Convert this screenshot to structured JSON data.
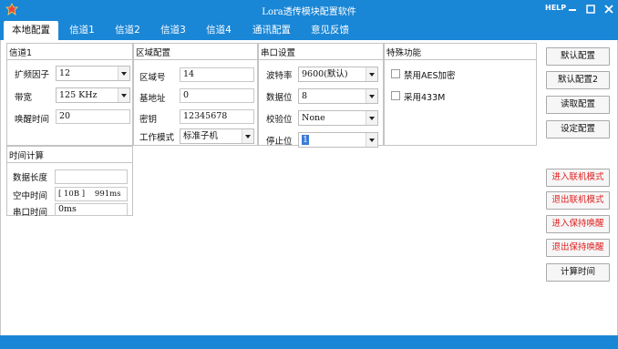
{
  "window": {
    "title": "Lora透传模块配置软件",
    "help_label": "HELP",
    "min_icon": "minimize-icon",
    "max_icon": "maximize-icon",
    "close_icon": "close-icon",
    "colors": {
      "titlebar": "#1a86d6",
      "red_button_text": "#e02020"
    }
  },
  "tabs": [
    {
      "label": "本地配置",
      "active": true
    },
    {
      "label": "信道1"
    },
    {
      "label": "信道2"
    },
    {
      "label": "信道3"
    },
    {
      "label": "信道4"
    },
    {
      "label": "通讯配置"
    },
    {
      "label": "意见反馈"
    }
  ],
  "channel": {
    "title": "信道1",
    "spread_factor": {
      "label": "扩频因子",
      "value": "12"
    },
    "bandwidth": {
      "label": "带宽",
      "value": "125 KHz"
    },
    "wake_time": {
      "label": "唤醒时间",
      "value": "20"
    }
  },
  "region": {
    "title": "区域配置",
    "area_id": {
      "label": "区域号",
      "value": "14"
    },
    "base_addr": {
      "label": "基地址",
      "value": "0"
    },
    "key": {
      "label": "密钥",
      "value": "12345678"
    },
    "work_mode": {
      "label": "工作模式",
      "value": "标准子机"
    }
  },
  "serial": {
    "title": "串口设置",
    "baud": {
      "label": "波特率",
      "value": "9600(默认)"
    },
    "data_bits": {
      "label": "数据位",
      "value": "8"
    },
    "parity": {
      "label": "校验位",
      "value": "None"
    },
    "stop_bits": {
      "label": "停止位",
      "value": "1"
    }
  },
  "special": {
    "title": "特殊功能",
    "disable_aes": {
      "label": "禁用AES加密",
      "checked": false
    },
    "use_433m": {
      "label": "采用433M",
      "checked": false
    }
  },
  "timing": {
    "title": "时间计算",
    "data_length": {
      "label": "数据长度",
      "value": ""
    },
    "air_time": {
      "label": "空中时间",
      "value": "[ 10B ]    991ms"
    },
    "serial_time": {
      "label": "串口时间",
      "value": "0ms"
    }
  },
  "buttons": {
    "default_config": "默认配置",
    "default_config2": "默认配置2",
    "read_config": "读取配置",
    "set_config": "设定配置",
    "enter_online": "进入联机模式",
    "exit_online": "退出联机模式",
    "enter_keepwake": "进入保持唤醒",
    "exit_keepwake": "退出保持唤醒",
    "calc_time": "计算时间"
  }
}
